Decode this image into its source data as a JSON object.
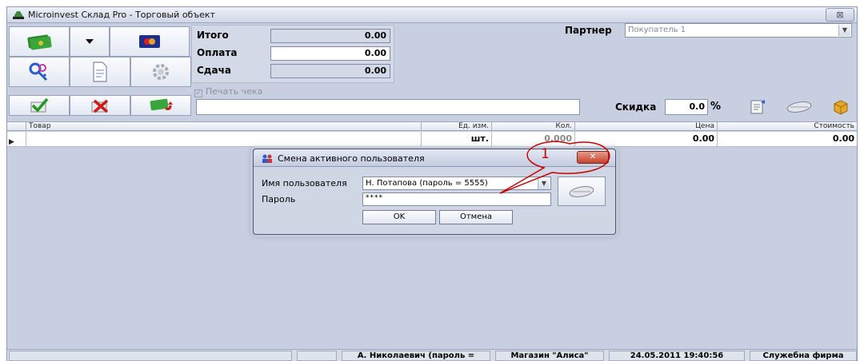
{
  "window": {
    "title": "Microinvest Склад Pro - Торговый объект",
    "close_glyph": "⊠"
  },
  "totals": {
    "total_label": "Итого",
    "total_value": "0.00",
    "payment_label": "Оплата",
    "payment_value": "0.00",
    "change_label": "Сдача",
    "change_value": "0.00",
    "print_receipt_label": "Печать чека"
  },
  "partner": {
    "label": "Партнер",
    "value": "Покупатель 1"
  },
  "discount": {
    "label": "Скидка",
    "value": "0.0",
    "unit": "%"
  },
  "grid": {
    "columns": [
      "Товар",
      "Ед. изм.",
      "Кол.",
      "Цена",
      "Стоимость"
    ],
    "rows": [
      {
        "item": "",
        "unit": "шт.",
        "qty": "0.000",
        "price": "0.00",
        "cost": "0.00"
      }
    ]
  },
  "dialog": {
    "title": "Смена активного пользователя",
    "close_glyph": "✕",
    "username_label": "Имя пользователя",
    "username_value": "Н. Потапова (пароль = 5555)",
    "password_label": "Пароль",
    "password_value": "****",
    "ok_label": "OK",
    "cancel_label": "Отмена"
  },
  "annotation": {
    "number": "1",
    "color": "#cc0000"
  },
  "statusbar": {
    "cells": [
      "",
      "",
      "А. Николаевич (пароль =",
      "Магазин \"Алиса\"",
      "24.05.2011 19:40:56",
      "Служебна фирма"
    ]
  },
  "icons": {
    "toolbar": [
      "cash-icon",
      "dropdown-arrow-icon",
      "card-icon",
      "keys-icon",
      "document-icon",
      "gear-icon",
      "check-icon",
      "delete-icon",
      "cash-return-icon"
    ],
    "side": [
      "notepad-icon",
      "card-reader-icon",
      "box-icon"
    ]
  },
  "colors": {
    "accent_red": "#cc0000",
    "background": "#c7cfe0"
  }
}
